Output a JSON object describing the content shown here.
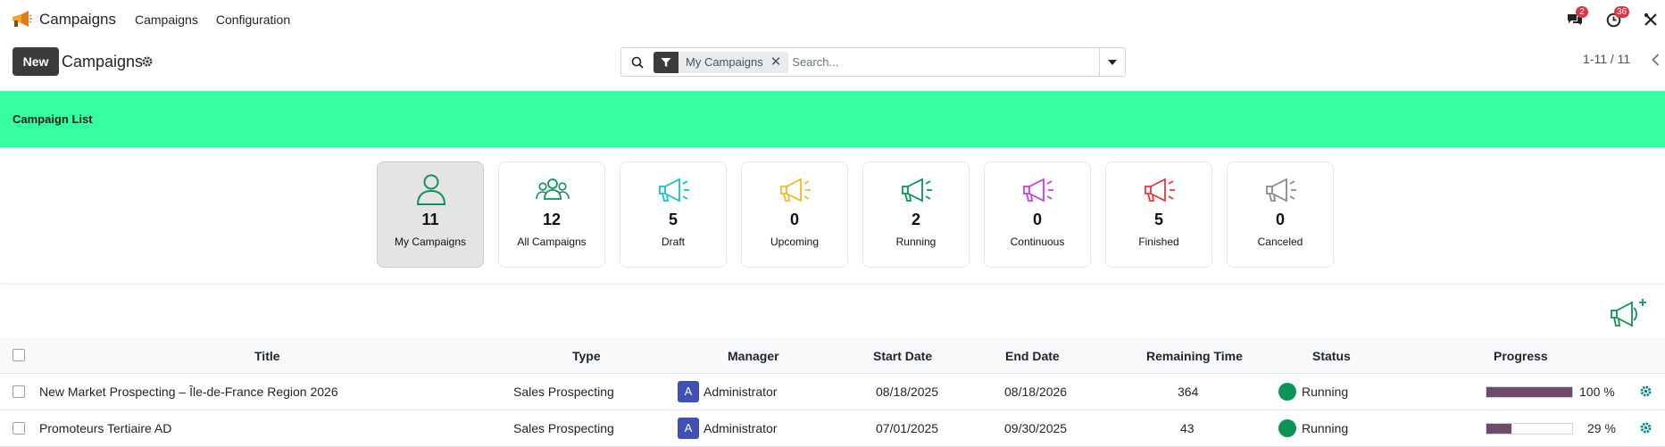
{
  "navbar": {
    "app_title": "Campaigns",
    "menu": [
      "Campaigns",
      "Configuration"
    ],
    "messages_count": "2",
    "activities_count": "36"
  },
  "control_panel": {
    "new_label": "New",
    "title": "Campaigns",
    "search": {
      "facet": "My Campaigns",
      "placeholder": "Search..."
    },
    "pager": "1-11 / 11"
  },
  "banner": {
    "title": "Campaign List"
  },
  "stat_cards": [
    {
      "count": "11",
      "label": "My Campaigns",
      "icon": "user-icon",
      "color": "#0b9455",
      "active": true
    },
    {
      "count": "12",
      "label": "All Campaigns",
      "icon": "users-icon",
      "color": "#0b9455"
    },
    {
      "count": "5",
      "label": "Draft",
      "icon": "megaphone-icon",
      "color": "#17c1c6"
    },
    {
      "count": "0",
      "label": "Upcoming",
      "icon": "megaphone-icon",
      "color": "#f5b82e"
    },
    {
      "count": "2",
      "label": "Running",
      "icon": "megaphone-icon",
      "color": "#0b9455"
    },
    {
      "count": "0",
      "label": "Continuous",
      "icon": "megaphone-icon",
      "color": "#c83ee0"
    },
    {
      "count": "5",
      "label": "Finished",
      "icon": "megaphone-icon",
      "color": "#e23b3b"
    },
    {
      "count": "0",
      "label": "Canceled",
      "icon": "megaphone-icon",
      "color": "#8a8a8a"
    }
  ],
  "table": {
    "headers": [
      "Title",
      "Type",
      "Manager",
      "Start Date",
      "End Date",
      "Remaining Time",
      "Status",
      "Progress"
    ],
    "rows": [
      {
        "title": "New Market Prospecting – Île-de-France Region 2026",
        "type": "Sales Prospecting",
        "manager_initial": "A",
        "manager": "Administrator",
        "start": "08/18/2025",
        "end": "08/18/2026",
        "remaining": "364",
        "status": "Running",
        "progress_value": 100,
        "progress": "100 %"
      },
      {
        "title": "Promoteurs Tertiaire AD",
        "type": "Sales Prospecting",
        "manager_initial": "A",
        "manager": "Administrator",
        "start": "07/01/2025",
        "end": "09/30/2025",
        "remaining": "43",
        "status": "Running",
        "progress_value": 29,
        "progress": "29 %"
      }
    ]
  },
  "colors": {
    "banner": "#37fea1",
    "running_status": "#0b9455",
    "progress_fill": "#6f4a6b",
    "badge": "#dc3545"
  }
}
